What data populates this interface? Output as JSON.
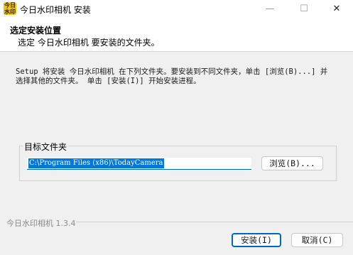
{
  "window": {
    "title": "今日水印相机 安装",
    "app_icon_text": "今日\n水印",
    "controls": {
      "minimize": "—",
      "maximize": "☐",
      "close": "✕"
    }
  },
  "header": {
    "title": "选定安装位置",
    "subtitle": "选定 今日水印相机 要安装的文件夹。"
  },
  "description": "Setup 将安装 今日水印相机 在下列文件夹。要安装到不同文件夹，单击 [浏览(B)...] 并选择其他的文件夹。 单击 [安装(I)] 开始安装进程。",
  "destination": {
    "group_label": "目标文件夹",
    "path_value": "C:\\Program Files (x86)\\TodayCamera",
    "browse_label": "浏览(B)..."
  },
  "footer": {
    "version_text": "今日水印相机 1.3.4",
    "install_label": "安装(I)",
    "cancel_label": "取消(C)"
  },
  "colors": {
    "accent": "#0067c0",
    "selection": "#0078d7",
    "background": "#f0f0f0",
    "header_background": "#ffffff"
  }
}
